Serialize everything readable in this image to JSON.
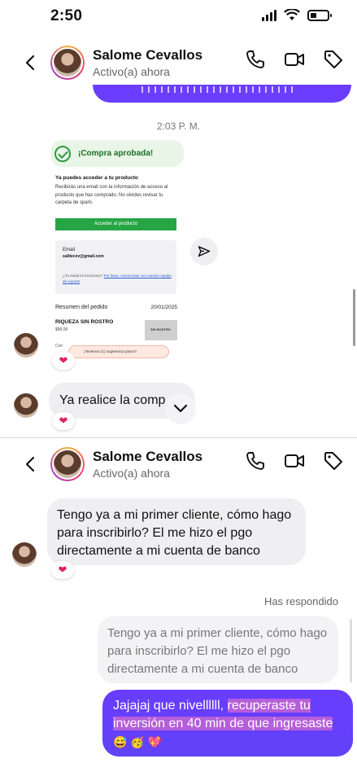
{
  "status_bar": {
    "time": "2:50"
  },
  "header": {
    "name": "Salome Cevallos",
    "status": "Activo(a) ahora",
    "actions": [
      "phone-icon",
      "video-icon",
      "tag-icon"
    ]
  },
  "timestamp": "2:03 P. M.",
  "purchase_screenshot": {
    "title": "¡Compra aprobada!",
    "heading": "Ya puedes acceder a tu producto",
    "body": "Recibirás una email con la información de acceso al producto que has comprado. No olvides revisar tu carpeta de spam.",
    "button": "Acceder al producto",
    "email_label": "Email",
    "email_value": "salitecev@gmail.com",
    "note_prefix": "¿Tu email es incorrecto?",
    "note_link": "Por favor, comunícate con nuestro equipo de soporte",
    "summary_label": "Resumen del pedido",
    "date": "20/01/2025",
    "product": "RIQUEZA SIN ROSTRO",
    "price": "$99.00",
    "thumb_text": "SIN ROSTRO",
    "bottom": "Con",
    "banner": "¡Tenemos (1) sugerencia para ti!"
  },
  "faded_message": "Ya realice la comp",
  "reaction": "❤",
  "second_header": {
    "name": "Salome Cevallos",
    "status": "Activo(a) ahora"
  },
  "messages": {
    "incoming": "Tengo ya a mi primer cliente, cómo hago para inscribirlo? El me hizo el pgo directamente a mi cuenta de banco",
    "replied_label": "Has respondido",
    "quoted": "Tengo ya a mi primer cliente, cómo hago para inscribirlo? El me hizo el pgo directamente a mi cuenta de banco",
    "sent_plain": "Jajajaj que nivellllll, ",
    "sent_highlight": "recuperaste tu inversión en 40 min de que ingresaste",
    "sent_emojis": "😅🥳💖"
  },
  "colors": {
    "sent_bubble": "#6a3cff",
    "incoming_bubble": "#efeff1",
    "approved_green": "#27a544"
  }
}
